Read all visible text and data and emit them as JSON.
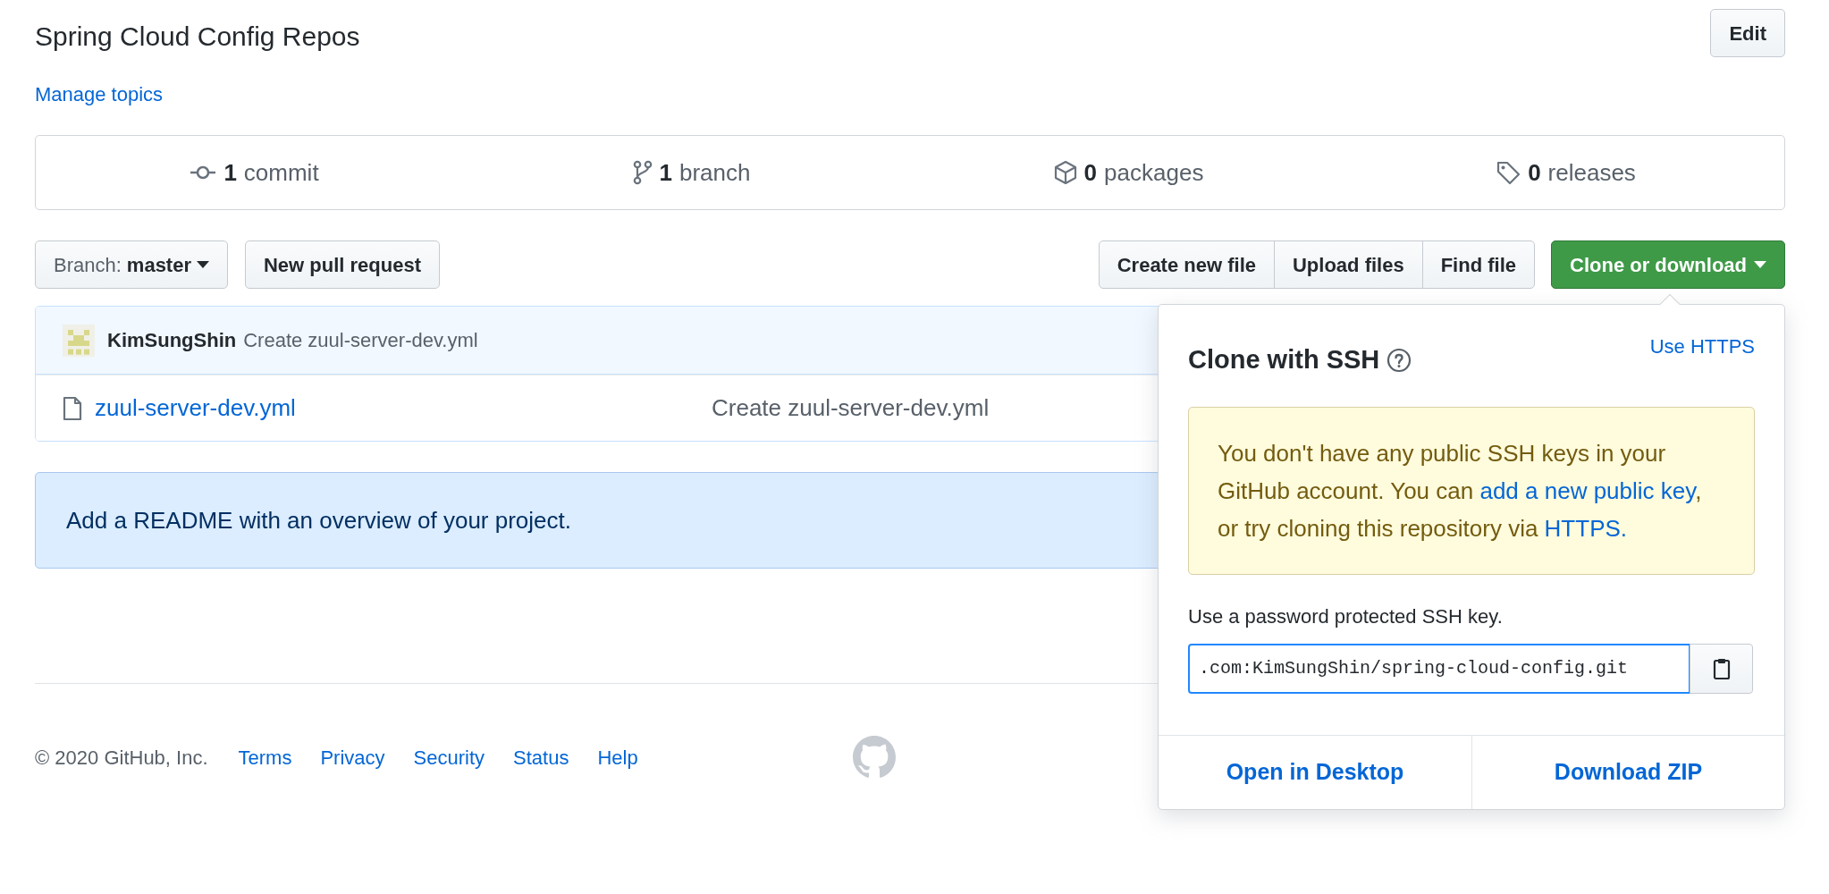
{
  "repo": {
    "description": "Spring Cloud Config Repos",
    "edit_button": "Edit",
    "manage_topics": "Manage topics"
  },
  "stats": [
    {
      "kind": "commit",
      "count": "1",
      "label": "commit"
    },
    {
      "kind": "branch",
      "count": "1",
      "label": "branch"
    },
    {
      "kind": "package",
      "count": "0",
      "label": "packages"
    },
    {
      "kind": "release",
      "count": "0",
      "label": "releases"
    }
  ],
  "branch_button": {
    "label": "Branch:",
    "value": "master"
  },
  "new_pull_request": "New pull request",
  "file_actions": [
    "Create new file",
    "Upload files",
    "Find file"
  ],
  "clone_button": "Clone or download",
  "latest_commit": {
    "author": "KimSungShin",
    "message": "Create zuul-server-dev.yml"
  },
  "files": [
    {
      "kind": "file",
      "name": "zuul-server-dev.yml",
      "message": "Create zuul-server-dev.yml"
    }
  ],
  "readme_banner": "Add a README with an overview of your project.",
  "footer": {
    "copyright": "© 2020 GitHub, Inc.",
    "links": [
      "Terms",
      "Privacy",
      "Security",
      "Status",
      "Help"
    ]
  },
  "clone_dropdown": {
    "title": "Clone with SSH",
    "switch_link": "Use HTTPS",
    "notice": [
      {
        "kind": "text",
        "text": "You don't have any public SSH keys in your GitHub account. You can "
      },
      {
        "kind": "link",
        "text": "add a new public key"
      },
      {
        "kind": "text",
        "text": ", or try cloning this repository via "
      },
      {
        "kind": "link",
        "text": "HTTPS."
      }
    ],
    "hint": "Use a password protected SSH key.",
    "url": ".com:KimSungShin/spring-cloud-config.git",
    "actions": [
      "Open in Desktop",
      "Download ZIP"
    ]
  }
}
